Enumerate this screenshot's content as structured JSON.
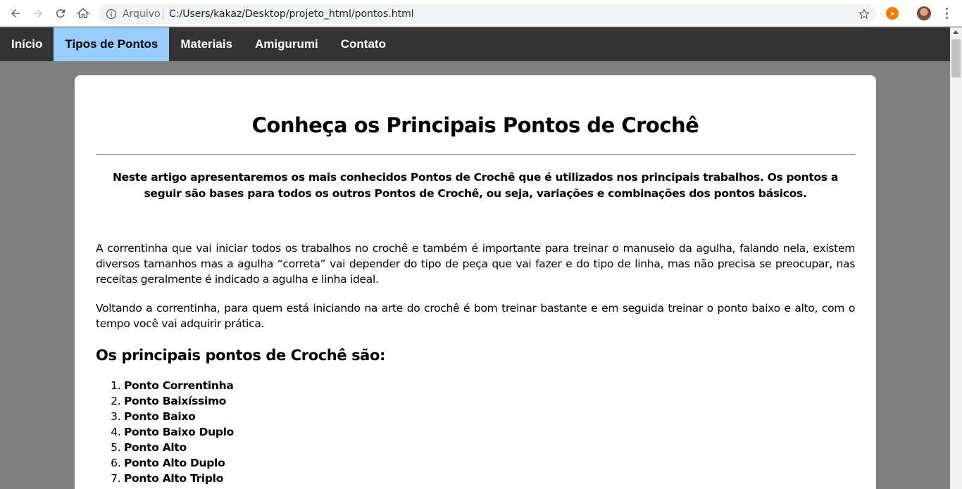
{
  "browser": {
    "omnibox_label": "Arquivo",
    "url": "C:/Users/kakaz/Desktop/projeto_html/pontos.html"
  },
  "nav": {
    "items": [
      {
        "label": "Início",
        "active": false
      },
      {
        "label": "Tipos de Pontos",
        "active": true
      },
      {
        "label": "Materiais",
        "active": false
      },
      {
        "label": "Amigurumi",
        "active": false
      },
      {
        "label": "Contato",
        "active": false
      }
    ]
  },
  "content": {
    "title": "Conheça os Principais Pontos de Crochê",
    "intro": "Neste artigo apresentaremos os mais conhecidos Pontos de Crochê que é utilizados nos principais trabalhos. Os pontos a seguir são bases para todos os outros Pontos de Crochê, ou seja, variações e combinações dos pontos básicos.",
    "paragraph1": "A correntinha que vai iniciar todos os trabalhos no crochê e também é importante para treinar o manuseio da agulha, falando nela, existem diversos tamanhos mas a agulha “correta” vai depender do tipo de peça que vai fazer e do tipo de linha, mas não precisa se preocupar, nas receitas geralmente é indicado a agulha e linha ideal.",
    "paragraph2": "Voltando a correntinha, para quem está iniciando na arte do crochê é bom treinar bastante e em seguida treinar o ponto baixo e alto, com o tempo você vai adquirir prática.",
    "list_heading": "Os principais pontos de Crochê são:",
    "stitches": [
      "Ponto Correntinha",
      "Ponto Baixíssimo",
      "Ponto Baixo",
      "Ponto Baixo Duplo",
      "Ponto Alto",
      "Ponto Alto Duplo",
      "Ponto Alto Triplo"
    ]
  },
  "colors": {
    "nav_bg": "#333333",
    "nav_active_bg": "#99ccff",
    "page_bg": "#808080",
    "card_bg": "#ffffff"
  }
}
